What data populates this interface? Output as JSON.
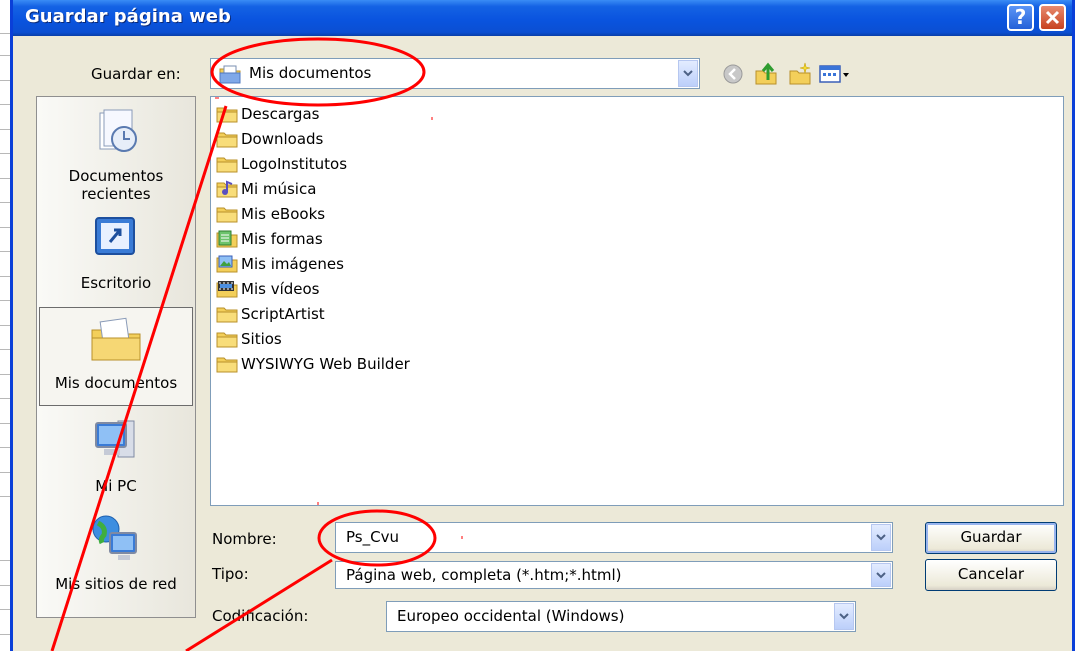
{
  "dialog": {
    "title": "Guardar página web",
    "help_label": "?",
    "close_label": "✕"
  },
  "save_in": {
    "label": "Guardar en:",
    "value": "Mis documentos"
  },
  "toolbar": {
    "icons": [
      "back-icon",
      "up-folder-icon",
      "new-folder-icon",
      "views-menu-icon"
    ]
  },
  "places": [
    {
      "label": "Documentos recientes",
      "line1": "Documentos",
      "line2": "recientes",
      "icon": "recent-documents-icon"
    },
    {
      "label": "Escritorio",
      "icon": "desktop-icon"
    },
    {
      "label": "Mis documentos",
      "icon": "my-documents-icon",
      "selected": true
    },
    {
      "label": "Mi PC",
      "icon": "my-computer-icon"
    },
    {
      "label": "Mis sitios de red",
      "icon": "network-places-icon"
    }
  ],
  "files": [
    {
      "name": "Descargas",
      "icon": "folder-icon"
    },
    {
      "name": "Downloads",
      "icon": "folder-icon"
    },
    {
      "name": "LogoInstitutos",
      "icon": "folder-icon"
    },
    {
      "name": "Mi música",
      "icon": "music-folder-icon"
    },
    {
      "name": "Mis eBooks",
      "icon": "folder-icon"
    },
    {
      "name": "Mis formas",
      "icon": "forms-folder-icon"
    },
    {
      "name": "Mis imágenes",
      "icon": "pictures-folder-icon"
    },
    {
      "name": "Mis vídeos",
      "icon": "videos-folder-icon"
    },
    {
      "name": "ScriptArtist",
      "icon": "folder-icon"
    },
    {
      "name": "Sitios",
      "icon": "folder-icon"
    },
    {
      "name": "WYSIWYG Web Builder",
      "icon": "folder-icon"
    }
  ],
  "form": {
    "name_label": "Nombre:",
    "name_value": "Ps_Cvu",
    "type_label": "Tipo:",
    "type_value": "Página web, completa (*.htm;*.html)",
    "encoding_label": "Codificación:",
    "encoding_value": "Europeo occidental (Windows)"
  },
  "buttons": {
    "save": "Guardar",
    "cancel": "Cancelar"
  },
  "colors": {
    "titlebar": "#0a54df",
    "dialog_bg": "#ece9d8",
    "annotation": "#ff0000"
  }
}
